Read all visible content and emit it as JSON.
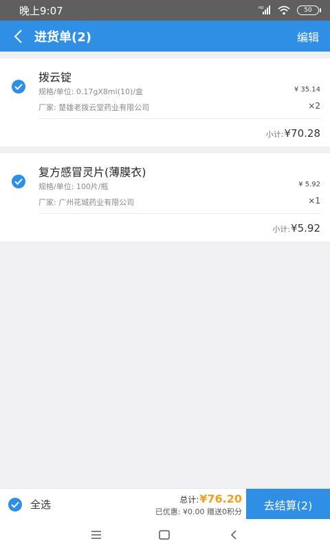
{
  "status_bar": {
    "time": "晚上9:07",
    "battery": "50"
  },
  "header": {
    "title": "进货单(2)",
    "edit_label": "编辑"
  },
  "items": [
    {
      "name": "拨云锭",
      "spec": "规格/单位: 0.17gX8ml(10)/盒",
      "manufacturer": "厂家: 楚雄老拨云堂药业有限公司",
      "price": "¥ 35.14",
      "quantity": "×2",
      "subtotal_label": "小计: ",
      "subtotal_value": "¥70.28"
    },
    {
      "name": "复方感冒灵片(薄膜衣)",
      "spec": "规格/单位: 100片/瓶",
      "manufacturer": "厂家: 广州花城药业有限公司",
      "price": "¥ 5.92",
      "quantity": "×1",
      "subtotal_label": "小计: ",
      "subtotal_value": "¥5.92"
    }
  ],
  "footer": {
    "select_all_label": "全选",
    "total_label": "总计:",
    "total_value": "¥76.20",
    "discount_text": "已优惠: ¥0.00 赠送0积分",
    "checkout_label": "去结算(2)"
  },
  "colors": {
    "accent": "#2f8fe5",
    "total": "#f0a020"
  }
}
